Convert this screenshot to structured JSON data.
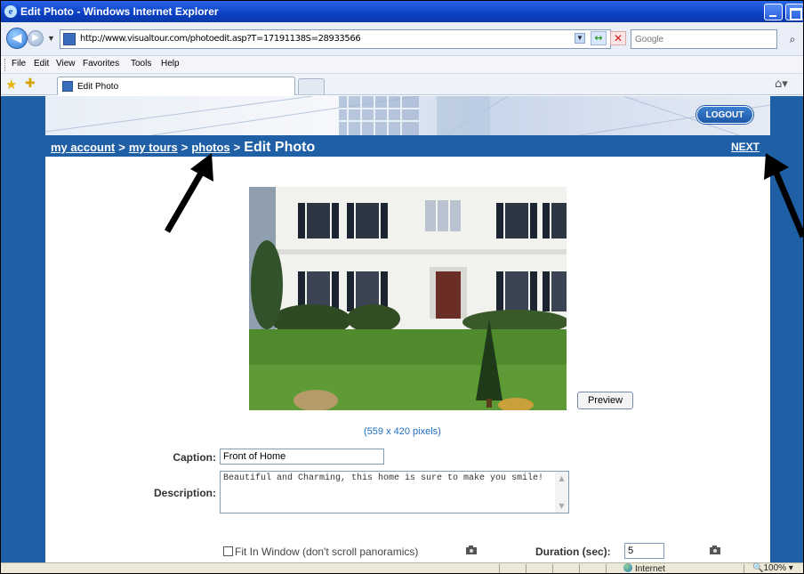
{
  "window": {
    "title": "Edit Photo - Windows Internet Explorer"
  },
  "addressbar": {
    "url": "http://www.visualtour.com/photoedit.asp?T=17191138S=28933566",
    "search_placeholder": "Google"
  },
  "menu": [
    "File",
    "Edit",
    "View",
    "Favorites",
    "Tools",
    "Help"
  ],
  "tab": {
    "label": "Edit Photo"
  },
  "banner": {
    "logout_label": "LOGOUT"
  },
  "breadcrumb": {
    "items": [
      "my account",
      "my tours",
      "photos"
    ],
    "separator": ">",
    "current": "Edit Photo",
    "next_label": "NEXT"
  },
  "photo": {
    "preview_label": "Preview",
    "dimensions": "(559 x 420 pixels)"
  },
  "form": {
    "caption_label": "Caption:",
    "caption_value": "Front of Home",
    "description_label": "Description:",
    "description_value": "Beautiful and Charming, this home is sure to make you smile!",
    "fit_label": "Fit In Window (don't scroll panoramics)",
    "duration_label": "Duration (sec):",
    "duration_value": "5"
  },
  "statusbar": {
    "zone": "Internet",
    "zoom": "100%"
  },
  "colors": {
    "page_blue": "#1f5fa5",
    "titlebar": "#0a3fc4",
    "link_blue": "#1f6fbf"
  }
}
